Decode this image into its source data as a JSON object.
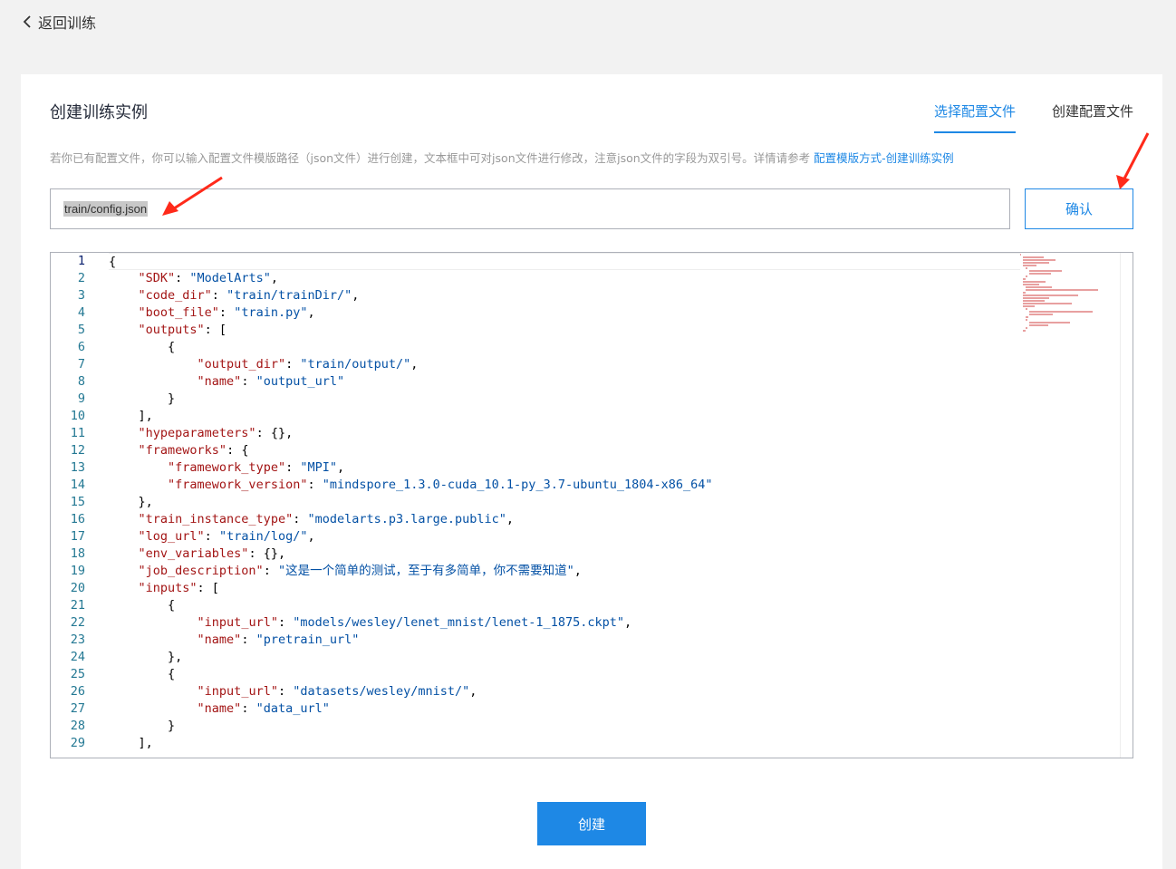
{
  "nav": {
    "back_label": "返回训练"
  },
  "page": {
    "title": "创建训练实例"
  },
  "tabs": [
    {
      "label": "选择配置文件",
      "active": true
    },
    {
      "label": "创建配置文件",
      "active": false
    }
  ],
  "hint": {
    "text": "若你已有配置文件，你可以输入配置文件模版路径（json文件）进行创建，文本框中可对json文件进行修改，注意json文件的字段为双引号。详情请参考 ",
    "link": "配置模版方式-创建训练实例"
  },
  "path_input": {
    "value": "train/config.json"
  },
  "confirm_button": "确认",
  "editor": {
    "current_line": 1,
    "lines": [
      "{",
      "    \"SDK\": \"ModelArts\",",
      "    \"code_dir\": \"train/trainDir/\",",
      "    \"boot_file\": \"train.py\",",
      "    \"outputs\": [",
      "        {",
      "            \"output_dir\": \"train/output/\",",
      "            \"name\": \"output_url\"",
      "        }",
      "    ],",
      "    \"hypeparameters\": {},",
      "    \"frameworks\": {",
      "        \"framework_type\": \"MPI\",",
      "        \"framework_version\": \"mindspore_1.3.0-cuda_10.1-py_3.7-ubuntu_1804-x86_64\"",
      "    },",
      "    \"train_instance_type\": \"modelarts.p3.large.public\",",
      "    \"log_url\": \"train/log/\",",
      "    \"env_variables\": {},",
      "    \"job_description\": \"这是一个简单的测试，至于有多简单，你不需要知道\",",
      "    \"inputs\": [",
      "        {",
      "            \"input_url\": \"models/wesley/lenet_mnist/lenet-1_1875.ckpt\",",
      "            \"name\": \"pretrain_url\"",
      "        },",
      "        {",
      "            \"input_url\": \"datasets/wesley/mnist/\",",
      "            \"name\": \"data_url\"",
      "        }",
      "    ],"
    ]
  },
  "create_button": "创建",
  "colors": {
    "accent": "#1e88e5",
    "annotation_arrow": "#ff2a1a"
  }
}
